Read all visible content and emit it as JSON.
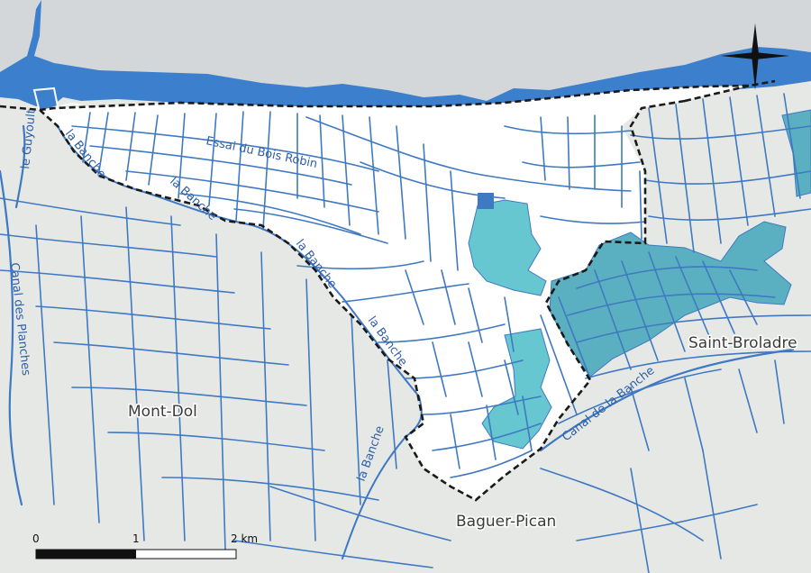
{
  "map": {
    "places": {
      "mont_dol": "Mont-Dol",
      "saint_broladre": "Saint-Broladre",
      "baguer_pican": "Baguer-Pican"
    },
    "waterways": {
      "la_banche_1": "la Banche",
      "la_banche_2": "la Banche",
      "la_banche_3": "la Banche",
      "la_banche_4": "la Banche",
      "la_banche_5": "la Banche",
      "la_banche_6": "la Banche",
      "essai_bois_robin": "Essai du Bois Robin",
      "le_guyoult": "le Guyoult",
      "canal_des_planches": "Canal des Planches",
      "canal_de_la_banche": "Canal de la Banche"
    },
    "scale_bar": {
      "tick_0": "0",
      "tick_1": "1",
      "tick_2": "2 km"
    },
    "colors": {
      "sea": "#d3d7d9",
      "tidal_water": "#3c7fcd",
      "commune_fill": "#ffffff",
      "surrounding_land": "#e6e8e6",
      "drainage_canal": "#3f79c2",
      "highlighted_parcel": "#67c7d1",
      "highlighted_parcel_dark": "#5ab0c0",
      "boundary": "#1a1a1a"
    },
    "icons": [
      "compass-rose-icon"
    ]
  }
}
